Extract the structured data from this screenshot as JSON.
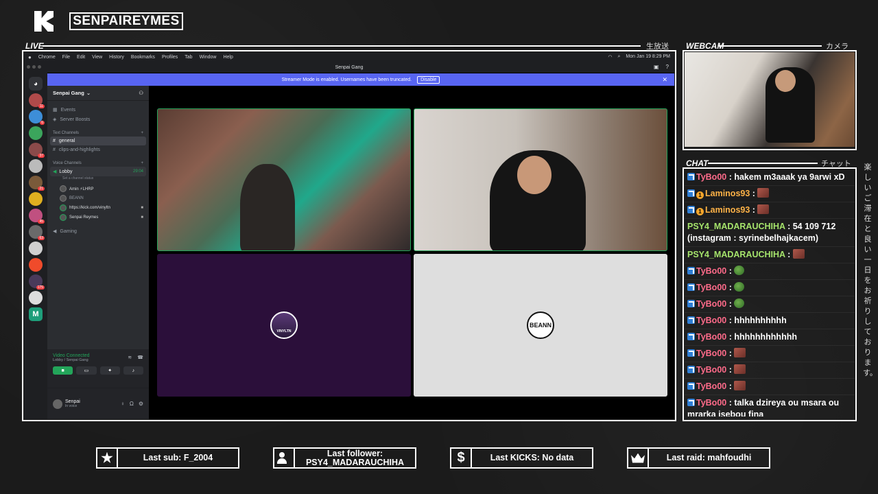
{
  "brand": {
    "name": "SENPAIREYMES"
  },
  "frames": {
    "live_label": "LIVE",
    "live_jp": "生放送",
    "webcam_label": "WEBCAM",
    "webcam_jp": "カメラ",
    "chat_label": "CHAT",
    "chat_jp": "チャット",
    "vertical_jp": "楽しいご滞在と良い一日をお祈りしております。"
  },
  "macos": {
    "menu": [
      "Chrome",
      "File",
      "Edit",
      "View",
      "History",
      "Bookmarks",
      "Profiles",
      "Tab",
      "Window",
      "Help"
    ],
    "clock": "Mon Jan 19  8:29 PM"
  },
  "discord": {
    "window_title": "Senpai Gang",
    "banner_text": "Streamer Mode is enabled. Usernames have been truncated.",
    "banner_button": "Disable",
    "server_name": "Senpai Gang",
    "events": "Events",
    "server_boosts": "Server Boosts",
    "text_channels_label": "Text Channels",
    "text_channels": [
      "general",
      "clips-and-highlights"
    ],
    "voice_channels_label": "Voice Channels",
    "lobby": {
      "name": "Lobby",
      "timer": "29:04",
      "status": "Set a channel status"
    },
    "voice_users": [
      "Amin ⚡LHRP",
      "BEANN",
      "https://kick.com/vinyltn",
      "Senpai Reymes"
    ],
    "gaming": "Gaming",
    "rtc": {
      "title": "Video Connected",
      "subtitle": "Lobby / Senpai Gang"
    },
    "user": {
      "name": "Senpai",
      "status": "In voice"
    },
    "tiles": {
      "vinyl_label": "VINYLTN",
      "beann_label": "BEANN"
    },
    "server_badges": [
      "11",
      "6",
      "37",
      "21",
      "45",
      "63",
      "175"
    ]
  },
  "chat": [
    {
      "badges": [
        "kick"
      ],
      "user": "TyBo00",
      "color": "#ff6b8a",
      "text": "hakem m3aaak ya 9arwi xD",
      "emote": ""
    },
    {
      "badges": [
        "kick",
        "sub"
      ],
      "user": "Laminos93",
      "color": "#ffb347",
      "text": "",
      "emote": "a"
    },
    {
      "badges": [
        "kick",
        "sub"
      ],
      "user": "Laminos93",
      "color": "#ffb347",
      "text": "",
      "emote": "a"
    },
    {
      "badges": [],
      "user": "PSY4_MADARAUCHIHA",
      "color": "#a5e36b",
      "text": "54 109 712 (instagram : syrinebelhajkacem)",
      "emote": ""
    },
    {
      "badges": [],
      "user": "PSY4_MADARAUCHIHA",
      "color": "#a5e36b",
      "text": "",
      "emote": "a"
    },
    {
      "badges": [
        "kick"
      ],
      "user": "TyBo00",
      "color": "#ff6b8a",
      "text": "",
      "emote": "b"
    },
    {
      "badges": [
        "kick"
      ],
      "user": "TyBo00",
      "color": "#ff6b8a",
      "text": "",
      "emote": "b"
    },
    {
      "badges": [
        "kick"
      ],
      "user": "TyBo00",
      "color": "#ff6b8a",
      "text": "",
      "emote": "b"
    },
    {
      "badges": [
        "kick"
      ],
      "user": "TyBo00",
      "color": "#ff6b8a",
      "text": "hhhhhhhhhh",
      "emote": ""
    },
    {
      "badges": [
        "kick"
      ],
      "user": "TyBo00",
      "color": "#ff6b8a",
      "text": "hhhhhhhhhhhh",
      "emote": ""
    },
    {
      "badges": [
        "kick"
      ],
      "user": "TyBo00",
      "color": "#ff6b8a",
      "text": "",
      "emote": "a"
    },
    {
      "badges": [
        "kick"
      ],
      "user": "TyBo00",
      "color": "#ff6b8a",
      "text": "",
      "emote": "a"
    },
    {
      "badges": [
        "kick"
      ],
      "user": "TyBo00",
      "color": "#ff6b8a",
      "text": "",
      "emote": "a"
    },
    {
      "badges": [
        "kick"
      ],
      "user": "TyBo00",
      "color": "#ff6b8a",
      "text": "talka dzireya ou msara ou mrarka isebou fina",
      "emote": ""
    }
  ],
  "stats": {
    "last_sub": "Last sub: F_2004",
    "last_follower_label": "Last follower:",
    "last_follower_name": "PSY4_MADARAUCHIHA",
    "last_kicks": "Last KICKS: No data",
    "last_raid": "Last raid: mahfoudhi"
  }
}
